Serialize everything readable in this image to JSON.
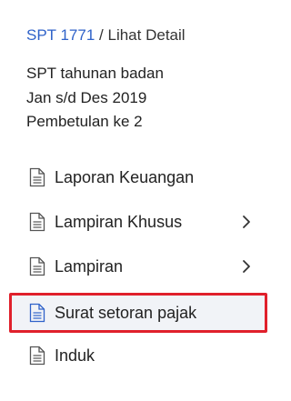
{
  "breadcrumb": {
    "link": "SPT 1771",
    "separator": "/",
    "current": "Lihat Detail"
  },
  "summary": {
    "line1": "SPT tahunan badan",
    "line2": "Jan s/d Des 2019",
    "line3": "Pembetulan ke 2"
  },
  "menu": {
    "items": [
      {
        "label": "Laporan Keuangan",
        "icon": "document-icon",
        "has_chevron": false
      },
      {
        "label": "Lampiran Khusus",
        "icon": "document-icon",
        "has_chevron": true
      },
      {
        "label": "Lampiran",
        "icon": "document-icon",
        "has_chevron": true
      },
      {
        "label": "Surat setoran pajak",
        "icon": "document-icon",
        "has_chevron": false,
        "highlighted": true
      },
      {
        "label": "Induk",
        "icon": "document-icon",
        "has_chevron": false
      }
    ]
  },
  "colors": {
    "link": "#2f62c9",
    "highlight_border": "#e0202b",
    "highlight_background": "#f1f3f7",
    "active_icon": "#2f62c9"
  }
}
